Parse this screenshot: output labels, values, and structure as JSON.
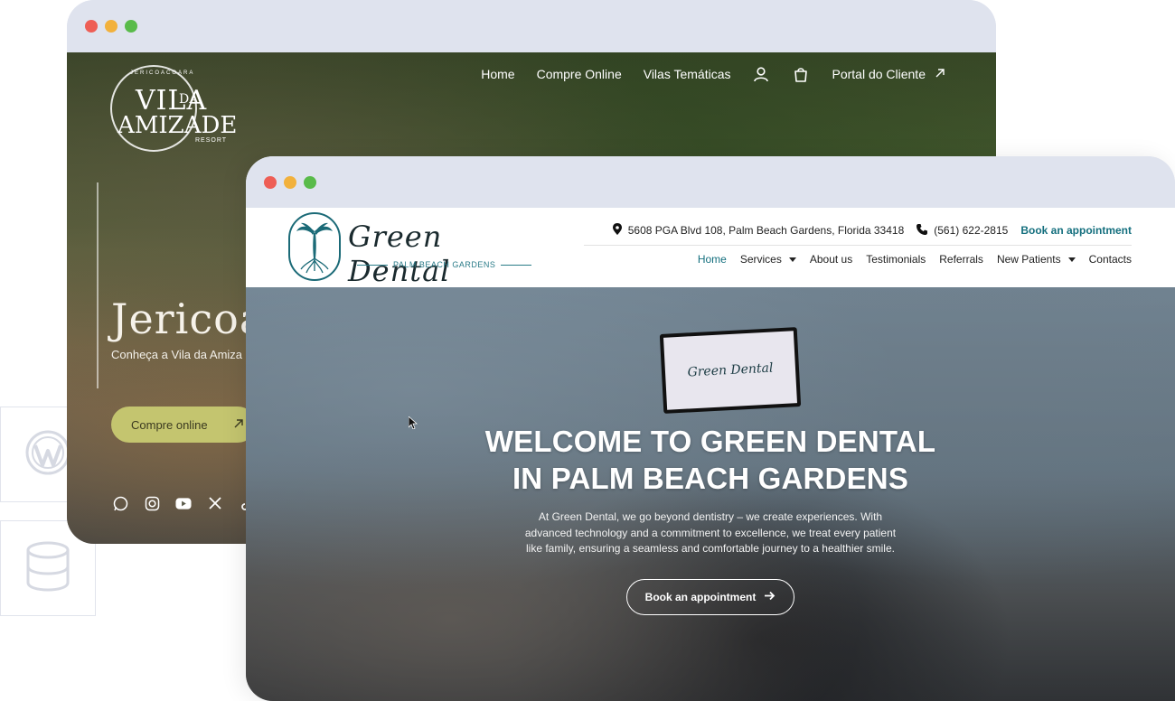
{
  "window_controls": {
    "close_color": "#ee5e55",
    "minimize_color": "#f2b13c",
    "maximize_color": "#59bb4a"
  },
  "side_icons": [
    "wordpress-icon",
    "database-icon"
  ],
  "vila_site": {
    "logo": {
      "top_text": "JERICOACOARA",
      "line1": "VILA",
      "line1_small": "DA",
      "line2": "AMIZADE",
      "tag": "RESORT"
    },
    "nav": [
      "Home",
      "Compre Online",
      "Vilas Temáticas"
    ],
    "portal_label": "Portal do Cliente",
    "hero_title": "Jericoa",
    "hero_subtitle": "Conheça a Vila da Amiza",
    "cta_label": "Compre online",
    "accent": "#c4c56f",
    "social": [
      "whatsapp-icon",
      "instagram-icon",
      "youtube-icon",
      "x-icon",
      "tiktok-icon"
    ]
  },
  "dental_site": {
    "logo": {
      "name": "Green Dental",
      "sub": "PALM BEACH GARDENS"
    },
    "address": "5608 PGA Blvd 108, Palm Beach Gardens, Florida 33418",
    "phone": "(561) 622-2815",
    "book_link": "Book an appointment",
    "nav": {
      "home": "Home",
      "services": "Services",
      "about": "About us",
      "testimonials": "Testimonials",
      "referrals": "Referrals",
      "new_patients": "New Patients",
      "contacts": "Contacts"
    },
    "monitor_text": "Green Dental",
    "hero": {
      "line1": "WELCOME TO GREEN DENTAL",
      "line2": "IN PALM BEACH GARDENS",
      "paragraph": "At Green Dental, we go beyond dentistry – we create experiences. With advanced technology and a commitment to excellence, we treat every patient like family, ensuring a seamless and comfortable journey to a healthier smile.",
      "cta": "Book an appointment"
    },
    "brand_color": "#146f7e"
  }
}
